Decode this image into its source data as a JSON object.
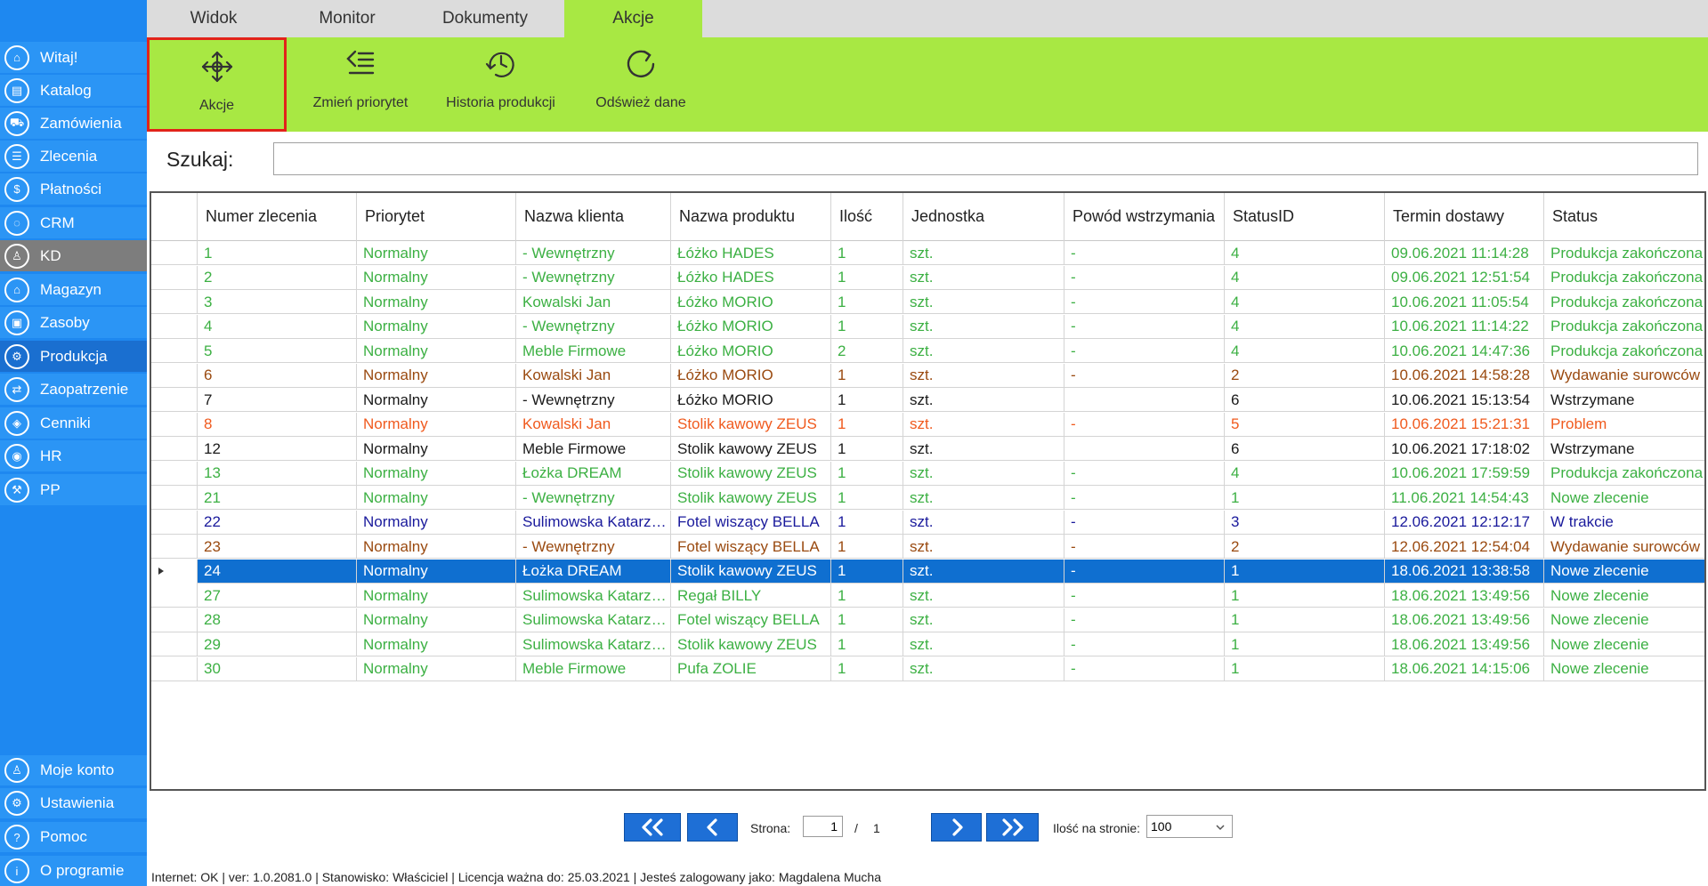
{
  "sidebar": {
    "items": [
      {
        "label": "Witaj!",
        "icon": "home-icon",
        "glyph": "⌂"
      },
      {
        "label": "Katalog",
        "icon": "catalog-icon",
        "glyph": "▤"
      },
      {
        "label": "Zamówienia",
        "icon": "cart-icon",
        "glyph": "⛟"
      },
      {
        "label": "Zlecenia",
        "icon": "list-icon",
        "glyph": "☰"
      },
      {
        "label": "Płatności",
        "icon": "dollar-icon",
        "glyph": "$"
      },
      {
        "label": "CRM",
        "icon": "crm-icon",
        "glyph": "◌"
      },
      {
        "label": "KD",
        "icon": "person-icon",
        "glyph": "♙"
      },
      {
        "label": "Magazyn",
        "icon": "warehouse-icon",
        "glyph": "⌂"
      },
      {
        "label": "Zasoby",
        "icon": "resources-icon",
        "glyph": "▣"
      },
      {
        "label": "Produkcja",
        "icon": "production-icon",
        "glyph": "⚙"
      },
      {
        "label": "Zaopatrzenie",
        "icon": "truck-icon",
        "glyph": "⇄"
      },
      {
        "label": "Cenniki",
        "icon": "tag-icon",
        "glyph": "◈"
      },
      {
        "label": "HR",
        "icon": "hr-icon",
        "glyph": "◉"
      },
      {
        "label": "PP",
        "icon": "pp-icon",
        "glyph": "⚒"
      }
    ],
    "bottom_items": [
      {
        "label": "Moje konto",
        "icon": "account-icon",
        "glyph": "♙"
      },
      {
        "label": "Ustawienia",
        "icon": "settings-icon",
        "glyph": "⚙"
      },
      {
        "label": "Pomoc",
        "icon": "help-icon",
        "glyph": "?"
      },
      {
        "label": "O programie",
        "icon": "info-icon",
        "glyph": "i"
      }
    ]
  },
  "tabs": [
    "Widok",
    "Monitor",
    "Dokumenty",
    "Akcje"
  ],
  "ribbon": {
    "buttons": [
      {
        "label": "Akcje",
        "icon": "move-arrows-icon"
      },
      {
        "label": "Zmień priorytet",
        "icon": "priority-list-icon"
      },
      {
        "label": "Historia produkcji",
        "icon": "history-icon"
      },
      {
        "label": "Odśwież dane",
        "icon": "refresh-icon"
      }
    ]
  },
  "search": {
    "label": "Szukaj:",
    "value": ""
  },
  "grid": {
    "columns": [
      "Numer zlecenia",
      "Priorytet",
      "Nazwa klienta",
      "Nazwa produktu",
      "Ilość",
      "Jednostka",
      "Powód wstrzymania",
      "StatusID",
      "Termin dostawy",
      "Status"
    ],
    "rows": [
      {
        "cells": [
          "1",
          "Normalny",
          "- Wewnętrzny",
          "Łóżko HADES",
          "1",
          "szt.",
          "-",
          "4",
          "09.06.2021 11:14:28",
          "Produkcja zakończona"
        ],
        "color": "green"
      },
      {
        "cells": [
          "2",
          "Normalny",
          "- Wewnętrzny",
          "Łóżko HADES",
          "1",
          "szt.",
          "-",
          "4",
          "09.06.2021 12:51:54",
          "Produkcja zakończona"
        ],
        "color": "green"
      },
      {
        "cells": [
          "3",
          "Normalny",
          "Kowalski Jan",
          "Łóżko MORIO",
          "1",
          "szt.",
          "-",
          "4",
          "10.06.2021 11:05:54",
          "Produkcja zakończona"
        ],
        "color": "green"
      },
      {
        "cells": [
          "4",
          "Normalny",
          "- Wewnętrzny",
          "Łóżko MORIO",
          "1",
          "szt.",
          "-",
          "4",
          "10.06.2021 11:14:22",
          "Produkcja zakończona"
        ],
        "color": "green"
      },
      {
        "cells": [
          "5",
          "Normalny",
          " Meble Firmowe",
          "Łóżko MORIO",
          "2",
          "szt.",
          "-",
          "4",
          "10.06.2021 14:47:36",
          "Produkcja zakończona"
        ],
        "color": "green"
      },
      {
        "cells": [
          "6",
          "Normalny",
          "Kowalski Jan",
          "Łóżko MORIO",
          "1",
          "szt.",
          "-",
          "2",
          "10.06.2021 14:58:28",
          "Wydawanie surowców"
        ],
        "color": "brown"
      },
      {
        "cells": [
          "7",
          "Normalny",
          "- Wewnętrzny",
          "Łóżko MORIO",
          "1",
          "szt.",
          "",
          "6",
          "10.06.2021 15:13:54",
          "Wstrzymane"
        ],
        "color": "black"
      },
      {
        "cells": [
          "8",
          "Normalny",
          "Kowalski Jan",
          "Stolik kawowy ZEUS",
          "1",
          "szt.",
          "-",
          "5",
          "10.06.2021 15:21:31",
          "Problem"
        ],
        "color": "orange"
      },
      {
        "cells": [
          "12",
          "Normalny",
          " Meble Firmowe",
          "Stolik kawowy ZEUS",
          "1",
          "szt.",
          "",
          "6",
          "10.06.2021 17:18:02",
          "Wstrzymane"
        ],
        "color": "black"
      },
      {
        "cells": [
          "13",
          "Normalny",
          " Łożka DREAM",
          "Stolik kawowy ZEUS",
          "1",
          "szt.",
          "-",
          "4",
          "10.06.2021 17:59:59",
          "Produkcja zakończona"
        ],
        "color": "green"
      },
      {
        "cells": [
          "21",
          "Normalny",
          "- Wewnętrzny",
          "Stolik kawowy ZEUS",
          "1",
          "szt.",
          "-",
          "1",
          "11.06.2021 14:54:43",
          "Nowe zlecenie"
        ],
        "color": "green"
      },
      {
        "cells": [
          "22",
          "Normalny",
          "Sulimowska Katarzyna",
          "Fotel wiszący BELLA",
          "1",
          "szt.",
          "-",
          "3",
          "12.06.2021 12:12:17",
          "W trakcie"
        ],
        "color": "navy"
      },
      {
        "cells": [
          "23",
          "Normalny",
          "- Wewnętrzny",
          "Fotel wiszący BELLA",
          "1",
          "szt.",
          "-",
          "2",
          "12.06.2021 12:54:04",
          "Wydawanie surowców"
        ],
        "color": "brown"
      },
      {
        "cells": [
          "24",
          "Normalny",
          " Łożka DREAM",
          "Stolik kawowy ZEUS",
          "1",
          "szt.",
          "-",
          "1",
          "18.06.2021 13:38:58",
          "Nowe zlecenie"
        ],
        "color": "green",
        "selected": true
      },
      {
        "cells": [
          "27",
          "Normalny",
          "Sulimowska Katarzyna",
          "Regał BILLY",
          "1",
          "szt.",
          "-",
          "1",
          "18.06.2021 13:49:56",
          "Nowe zlecenie"
        ],
        "color": "green"
      },
      {
        "cells": [
          "28",
          "Normalny",
          "Sulimowska Katarzyna",
          "Fotel wiszący BELLA",
          "1",
          "szt.",
          "-",
          "1",
          "18.06.2021 13:49:56",
          "Nowe zlecenie"
        ],
        "color": "green"
      },
      {
        "cells": [
          "29",
          "Normalny",
          "Sulimowska Katarzyna",
          "Stolik kawowy ZEUS",
          "1",
          "szt.",
          "-",
          "1",
          "18.06.2021 13:49:56",
          "Nowe zlecenie"
        ],
        "color": "green"
      },
      {
        "cells": [
          "30",
          "Normalny",
          " Meble Firmowe",
          "Pufa ZOLIE",
          "1",
          "szt.",
          "-",
          "1",
          "18.06.2021 14:15:06",
          "Nowe zlecenie"
        ],
        "color": "green"
      }
    ]
  },
  "pagination": {
    "page_label": "Strona:",
    "current_page": "1",
    "separator": "/",
    "total_pages": "1",
    "per_page_label": "Ilość na stronie:",
    "per_page_value": "100"
  },
  "statusbar": {
    "text": "Internet: OK  |   ver: 1.0.2081.0   |   Stanowisko: Właściciel    |   Licencja ważna do: 25.03.2021   |   Jesteś zalogowany jako: Magdalena Mucha"
  },
  "colors": {
    "sidebar": "#1e88f0",
    "ribbon": "#a8e843",
    "selected_row": "#0f6fd0",
    "focus_border": "#e2231a",
    "green_text": "#3cb043",
    "brown_text": "#9a4a10",
    "orange_text": "#f05a1e",
    "navy_text": "#1a1a9c"
  }
}
